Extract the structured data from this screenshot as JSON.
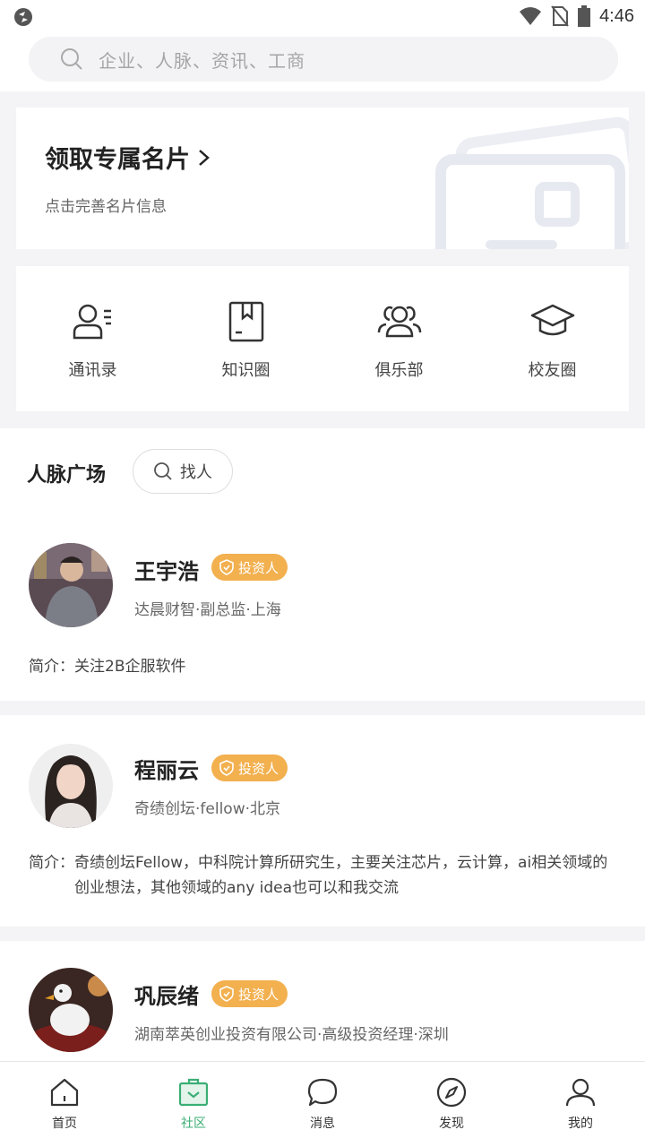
{
  "status_bar": {
    "time": "4:46"
  },
  "search": {
    "placeholder": "企业、人脉、资讯、工商"
  },
  "card_banner": {
    "title": "领取专属名片",
    "subtitle": "点击完善名片信息"
  },
  "quick_links": [
    {
      "label": "通讯录",
      "icon": "contacts-icon"
    },
    {
      "label": "知识圈",
      "icon": "bookmark-book-icon"
    },
    {
      "label": "俱乐部",
      "icon": "group-icon"
    },
    {
      "label": "校友圈",
      "icon": "graduation-cap-icon"
    }
  ],
  "square": {
    "title": "人脉广场",
    "find_label": "找人"
  },
  "people": [
    {
      "name": "王宇浩",
      "badge": "投资人",
      "info": "达晨财智·副总监·上海",
      "intro_label": "简介：",
      "intro": "关注2B企服软件"
    },
    {
      "name": "程丽云",
      "badge": "投资人",
      "info": "奇绩创坛·fellow·北京",
      "intro_label": "简介：",
      "intro": "奇绩创坛Fellow，中科院计算所研究生，主要关注芯片，云计算，ai相关领域的创业想法，其他领域的any idea也可以和我交流"
    },
    {
      "name": "巩辰绪",
      "badge": "投资人",
      "info": "湖南萃英创业投资有限公司·高级投资经理·深圳"
    }
  ],
  "tabs": [
    {
      "label": "首页",
      "icon": "home-icon"
    },
    {
      "label": "社区",
      "icon": "community-bag-icon",
      "active": true
    },
    {
      "label": "消息",
      "icon": "chat-bubble-icon"
    },
    {
      "label": "发现",
      "icon": "compass-icon"
    },
    {
      "label": "我的",
      "icon": "person-icon"
    }
  ],
  "colors": {
    "accent": "#3aae74",
    "badge": "#f2b04f"
  }
}
